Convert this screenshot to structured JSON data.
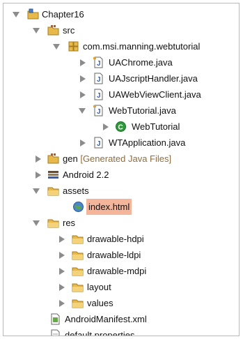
{
  "tree": {
    "project": "Chapter16",
    "src": "src",
    "package": "com.msi.manning.webtutorial",
    "files": {
      "uachrome": "UAChrome.java",
      "uajscript": "UAJscriptHandler.java",
      "uawebviewclient": "UAWebViewClient.java",
      "webtutorial": "WebTutorial.java",
      "webtutorial_class": "WebTutorial",
      "wtapplication": "WTApplication.java"
    },
    "gen": {
      "name": "gen",
      "suffix": "[Generated Java Files]"
    },
    "android": "Android 2.2",
    "assets": "assets",
    "index_html": "index.html",
    "res": "res",
    "res_folders": [
      "drawable-hdpi",
      "drawable-ldpi",
      "drawable-mdpi",
      "layout",
      "values"
    ],
    "manifest": "AndroidManifest.xml",
    "properties": "default.properties"
  },
  "colors": {
    "selection": "#f5b59b",
    "folder": "#e7b84a",
    "java_blue": "#3b5ea8",
    "class_green": "#2f9a3a"
  },
  "icons": {
    "project": "project-icon",
    "source_folder": "source-folder-icon",
    "package": "package-icon",
    "java_file": "java-file-icon",
    "class": "class-icon",
    "library": "library-icon",
    "folder": "folder-icon",
    "web": "globe-icon",
    "xml": "xml-file-icon",
    "properties": "properties-file-icon"
  }
}
